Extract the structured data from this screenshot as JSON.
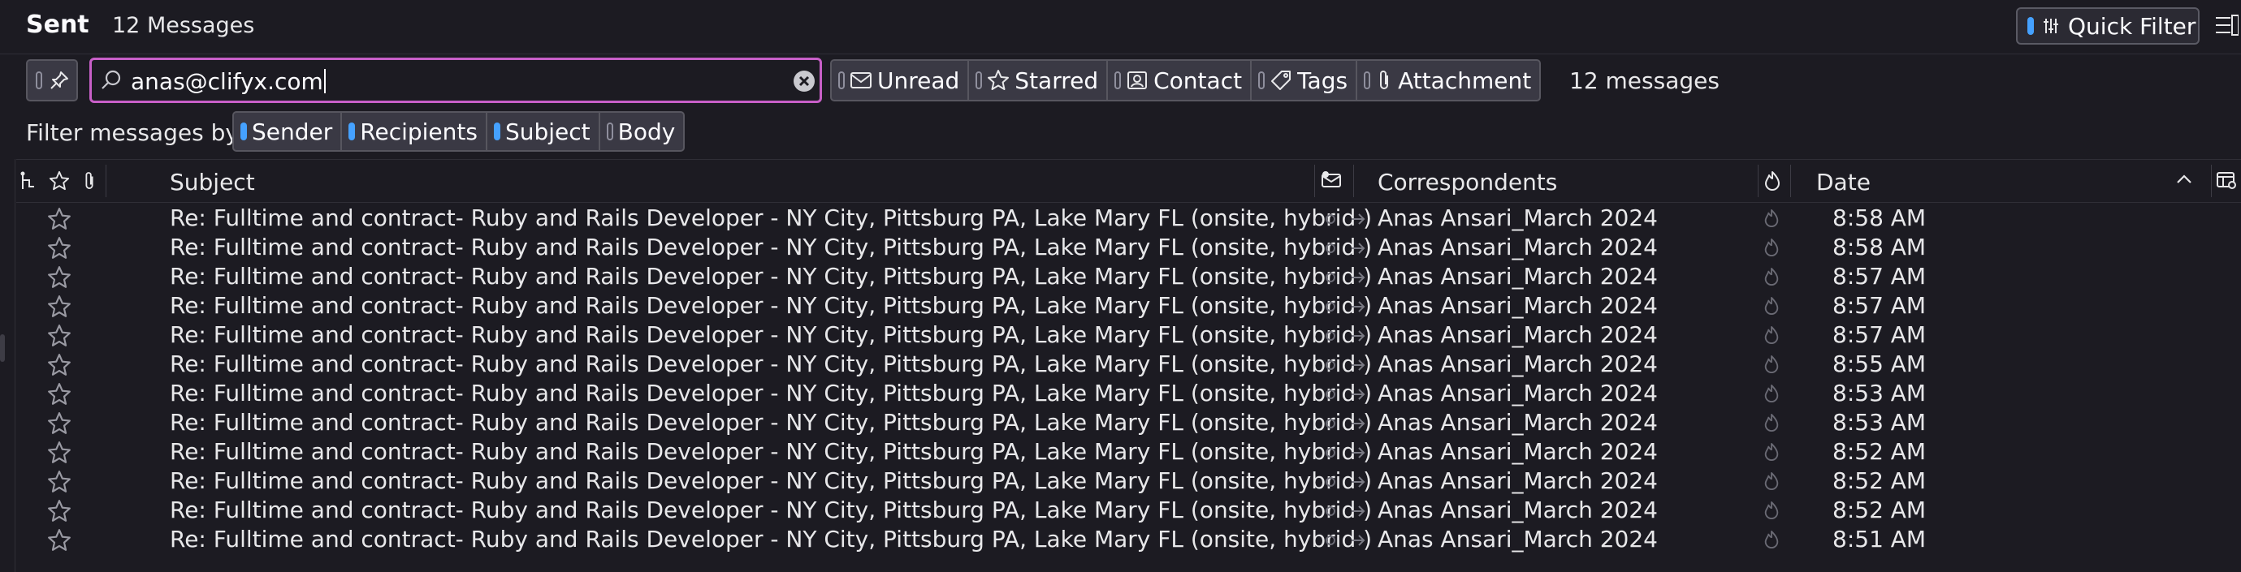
{
  "header": {
    "folder": "Sent",
    "count": "12 Messages",
    "quick_filter_label": "Quick Filter"
  },
  "filter": {
    "search_value": "anas@clifyx.com",
    "buttons": [
      "Unread",
      "Starred",
      "Contact",
      "Tags",
      "Attachment"
    ],
    "result_count": "12 messages",
    "by_label": "Filter messages by:",
    "by_options": [
      "Sender",
      "Recipients",
      "Subject",
      "Body"
    ],
    "by_enabled": [
      true,
      true,
      true,
      false
    ]
  },
  "columns": {
    "subject": "Subject",
    "correspondents": "Correspondents",
    "date": "Date"
  },
  "rows": [
    {
      "subject": "Re: Fulltime and contract- Ruby and Rails Developer - NY City, Pittsburg PA, Lake Mary FL (onsite, hybrid )",
      "correspondent": "Anas Ansari_March 2024",
      "date": "8:58 AM"
    },
    {
      "subject": "Re: Fulltime and contract- Ruby and Rails Developer - NY City, Pittsburg PA, Lake Mary FL (onsite, hybrid )",
      "correspondent": "Anas Ansari_March 2024",
      "date": "8:58 AM"
    },
    {
      "subject": "Re: Fulltime and contract- Ruby and Rails Developer - NY City, Pittsburg PA, Lake Mary FL (onsite, hybrid )",
      "correspondent": "Anas Ansari_March 2024",
      "date": "8:57 AM"
    },
    {
      "subject": "Re: Fulltime and contract- Ruby and Rails Developer - NY City, Pittsburg PA, Lake Mary FL (onsite, hybrid )",
      "correspondent": "Anas Ansari_March 2024",
      "date": "8:57 AM"
    },
    {
      "subject": "Re: Fulltime and contract- Ruby and Rails Developer - NY City, Pittsburg PA, Lake Mary FL (onsite, hybrid )",
      "correspondent": "Anas Ansari_March 2024",
      "date": "8:57 AM"
    },
    {
      "subject": "Re: Fulltime and contract- Ruby and Rails Developer - NY City, Pittsburg PA, Lake Mary FL (onsite, hybrid )",
      "correspondent": "Anas Ansari_March 2024",
      "date": "8:55 AM"
    },
    {
      "subject": "Re: Fulltime and contract- Ruby and Rails Developer - NY City, Pittsburg PA, Lake Mary FL (onsite, hybrid )",
      "correspondent": "Anas Ansari_March 2024",
      "date": "8:53 AM"
    },
    {
      "subject": "Re: Fulltime and contract- Ruby and Rails Developer - NY City, Pittsburg PA, Lake Mary FL (onsite, hybrid )",
      "correspondent": "Anas Ansari_March 2024",
      "date": "8:53 AM"
    },
    {
      "subject": "Re: Fulltime and contract- Ruby and Rails Developer - NY City, Pittsburg PA, Lake Mary FL (onsite, hybrid )",
      "correspondent": "Anas Ansari_March 2024",
      "date": "8:52 AM"
    },
    {
      "subject": "Re: Fulltime and contract- Ruby and Rails Developer - NY City, Pittsburg PA, Lake Mary FL (onsite, hybrid )",
      "correspondent": "Anas Ansari_March 2024",
      "date": "8:52 AM"
    },
    {
      "subject": "Re: Fulltime and contract- Ruby and Rails Developer - NY City, Pittsburg PA, Lake Mary FL (onsite, hybrid )",
      "correspondent": "Anas Ansari_March 2024",
      "date": "8:52 AM"
    },
    {
      "subject": "Re: Fulltime and contract- Ruby and Rails Developer - NY City, Pittsburg PA, Lake Mary FL (onsite, hybrid )",
      "correspondent": "Anas Ansari_March 2024",
      "date": "8:51 AM"
    }
  ],
  "icons": {
    "filter_buttons": [
      "envelope-icon",
      "star-icon",
      "contact-card-icon",
      "tag-icon",
      "paperclip-icon"
    ],
    "row_star": "star-icon",
    "row_read": "read-status-dot-icon",
    "row_sent": "arrow-right-icon",
    "row_junk": "junk-flame-icon"
  },
  "colors": {
    "background": "#1c1b22",
    "accent": "#45a1ff",
    "search_focus": "#c85fc8"
  }
}
